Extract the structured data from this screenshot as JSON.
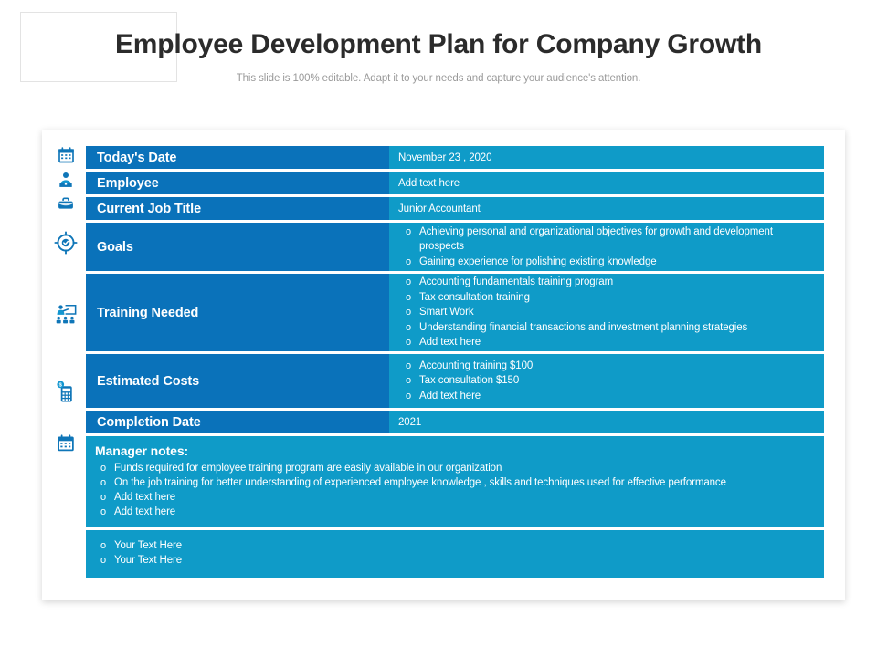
{
  "header": {
    "title": "Employee Development Plan for Company Growth",
    "subtitle": "This slide is 100% editable. Adapt it to your needs and capture your audience's attention."
  },
  "colors": {
    "label_cell": "#0a72ba",
    "value_cell": "#0f9bc8",
    "icon": "#0f76b8",
    "title_text": "#2b2b2b",
    "subtitle_text": "#9a9a9a"
  },
  "icons": [
    "calendar-icon",
    "employee-icon",
    "briefcase-icon",
    "target-icon",
    "training-icon",
    "calculator-icon",
    "calendar-date-icon"
  ],
  "table": {
    "rows": [
      {
        "label": "Today's Date",
        "value": "November 23 , 2020"
      },
      {
        "label": "Employee",
        "value": "Add text here"
      },
      {
        "label": "Current Job Title",
        "value": "Junior Accountant"
      },
      {
        "label": "Goals",
        "bullets": [
          "Achieving personal and organizational objectives for growth and development prospects",
          "Gaining experience for polishing existing knowledge"
        ]
      },
      {
        "label": "Training Needed",
        "bullets": [
          "Accounting fundamentals training program",
          "Tax consultation training",
          "Smart Work",
          "Understanding financial transactions and investment planning strategies",
          "Add text here"
        ]
      },
      {
        "label": "Estimated Costs",
        "bullets": [
          "Accounting training $100",
          "Tax consultation $150",
          "Add text here"
        ]
      },
      {
        "label": "Completion Date",
        "value": "2021"
      }
    ],
    "manager_notes": {
      "title": "Manager notes:",
      "bullets": [
        "Funds required for employee training program are easily available in our organization",
        "On the job training for better understanding of experienced employee knowledge , skills and techniques used for effective performance",
        "Add text here",
        "Add text here"
      ]
    },
    "extra_notes": {
      "bullets": [
        "Your Text Here",
        "Your Text Here"
      ]
    }
  }
}
